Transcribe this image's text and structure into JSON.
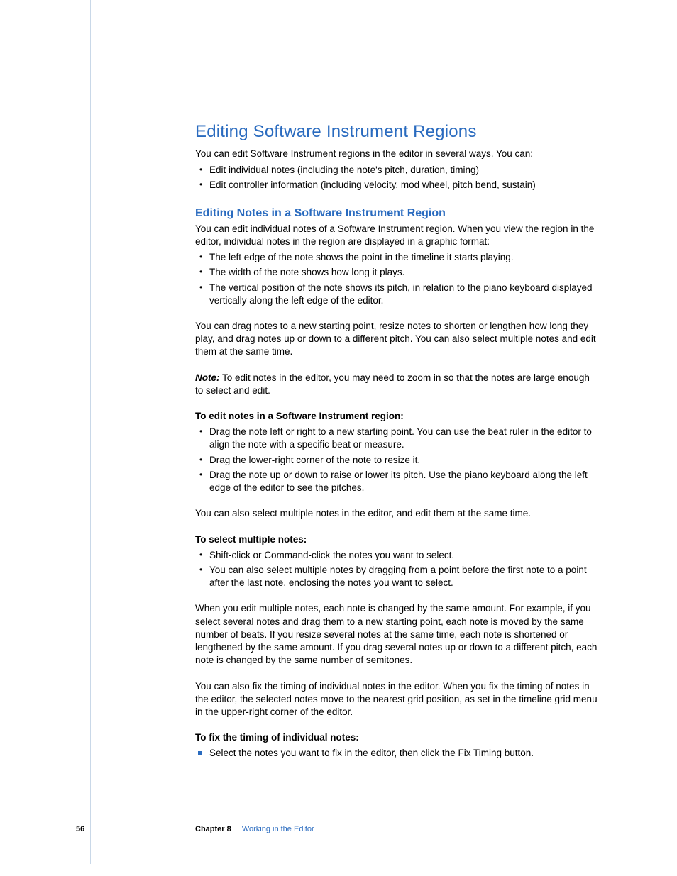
{
  "heading": "Editing Software Instrument Regions",
  "intro": "You can edit Software Instrument regions in the editor in several ways. You can:",
  "intro_bullets": [
    "Edit individual notes (including the note's pitch, duration, timing)",
    "Edit controller information (including velocity, mod wheel, pitch bend, sustain)"
  ],
  "sub_heading": "Editing Notes in a Software Instrument Region",
  "sub_intro": "You can edit individual notes of a Software Instrument region. When you view the region in the editor, individual notes in the region are displayed in a graphic format:",
  "sub_bullets": [
    "The left edge of the note shows the point in the timeline it starts playing.",
    "The width of the note shows how long it plays.",
    "The vertical position of the note shows its pitch, in relation to the piano keyboard displayed vertically along the left edge of the editor."
  ],
  "para1": "You can drag notes to a new starting point, resize notes to shorten or lengthen how long they play, and drag notes up or down to a different pitch. You can also select multiple notes and edit them at the same time.",
  "note_label": "Note:",
  "note_text": "  To edit notes in the editor, you may need to zoom in so that the notes are large enough to select and edit.",
  "task1_title": "To edit notes in a Software Instrument region:",
  "task1_bullets": [
    "Drag the note left or right to a new starting point. You can use the beat ruler in the editor to align the note with a specific beat or measure.",
    "Drag the lower-right corner of the note to resize it.",
    "Drag the note up or down to raise or lower its pitch. Use the piano keyboard along the left edge of the editor to see the pitches."
  ],
  "para2": "You can also select multiple notes in the editor, and edit them at the same time.",
  "task2_title": "To select multiple notes:",
  "task2_bullets": [
    "Shift-click or Command-click the notes you want to select.",
    "You can also select multiple notes by dragging from a point before the first note to a point after the last note, enclosing the notes you want to select."
  ],
  "para3": "When you edit multiple notes, each note is changed by the same amount. For example, if you select several notes and drag them to a new starting point, each note is moved by the same number of beats. If you resize several notes at the same time, each note is shortened or lengthened by the same amount. If you drag several notes up or down to a different pitch, each note is changed by the same number of semitones.",
  "para4": "You can also fix the timing of individual notes in the editor. When you fix the timing of notes in the editor, the selected notes move to the nearest grid position, as set in the timeline grid menu in the upper-right corner of the editor.",
  "task3_title": "To fix the timing of individual notes:",
  "task3_bullets": [
    "Select the notes you want to fix in the editor, then click the Fix Timing button."
  ],
  "footer": {
    "page_number": "56",
    "chapter_label": "Chapter 8",
    "chapter_title": "Working in the Editor"
  }
}
